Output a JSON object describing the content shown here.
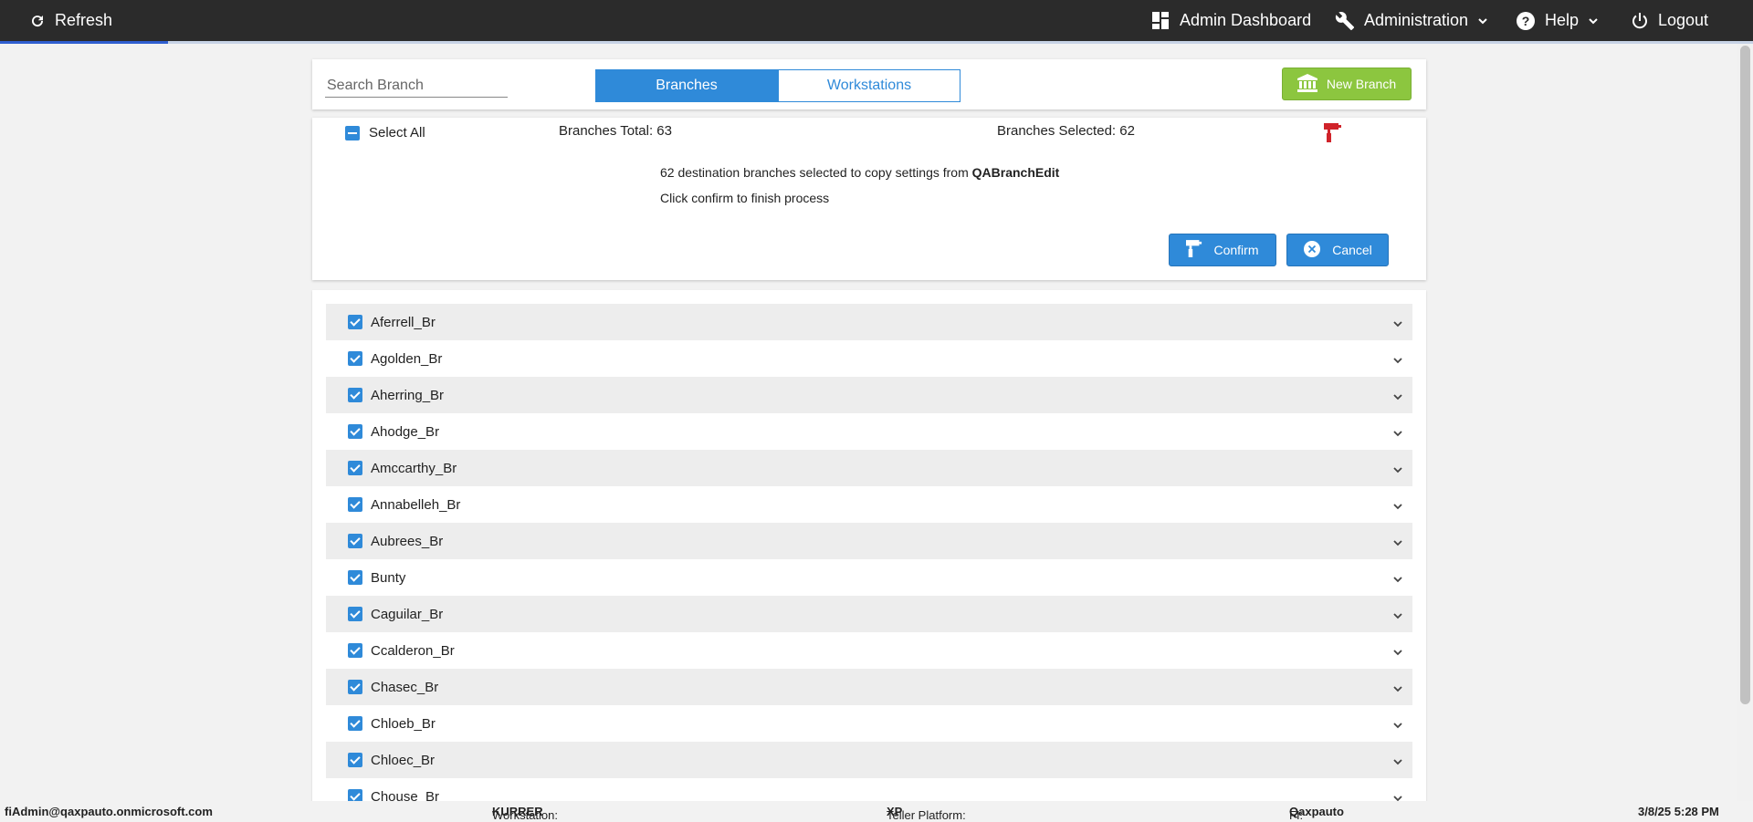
{
  "topbar": {
    "refresh_label": "Refresh",
    "dashboard_label": "Admin Dashboard",
    "administration_label": "Administration",
    "help_label": "Help",
    "logout_label": "Logout"
  },
  "header": {
    "search_placeholder": "Search Branch",
    "tabs": [
      {
        "label": "Branches",
        "active": true
      },
      {
        "label": "Workstations",
        "active": false
      }
    ],
    "new_branch_label": "New Branch"
  },
  "copy_panel": {
    "select_all_label": "Select All",
    "total_label": "Branches Total: 63",
    "selected_label": "Branches Selected: 62",
    "message_prefix": "62 destination branches selected to copy settings from ",
    "source_branch": "QABranchEdit",
    "instruction": "Click confirm to finish process",
    "confirm_label": "Confirm",
    "cancel_label": "Cancel"
  },
  "branches": [
    {
      "name": "Aferrell_Br",
      "checked": true
    },
    {
      "name": "Agolden_Br",
      "checked": true
    },
    {
      "name": "Aherring_Br",
      "checked": true
    },
    {
      "name": "Ahodge_Br",
      "checked": true
    },
    {
      "name": "Amccarthy_Br",
      "checked": true
    },
    {
      "name": "Annabelleh_Br",
      "checked": true
    },
    {
      "name": "Aubrees_Br",
      "checked": true
    },
    {
      "name": "Bunty",
      "checked": true
    },
    {
      "name": "Caguilar_Br",
      "checked": true
    },
    {
      "name": "Ccalderon_Br",
      "checked": true
    },
    {
      "name": "Chasec_Br",
      "checked": true
    },
    {
      "name": "Chloeb_Br",
      "checked": true
    },
    {
      "name": "Chloec_Br",
      "checked": true
    },
    {
      "name": "Chouse_Br",
      "checked": true
    }
  ],
  "footer": {
    "user": "fiAdmin@qaxpauto.onmicrosoft.com",
    "workstation_label": "Workstation: ",
    "workstation": "KURRER",
    "platform_label": "Teller Platform: ",
    "platform": "XP",
    "fi_label": "FI: ",
    "fi": "Qaxpauto",
    "datetime": "3/8/25 5:28 PM"
  },
  "colors": {
    "accent": "#2f8ad9",
    "new_branch": "#8cc63f",
    "topbar": "#2b2b2b",
    "paint_icon": "#d0232a"
  }
}
